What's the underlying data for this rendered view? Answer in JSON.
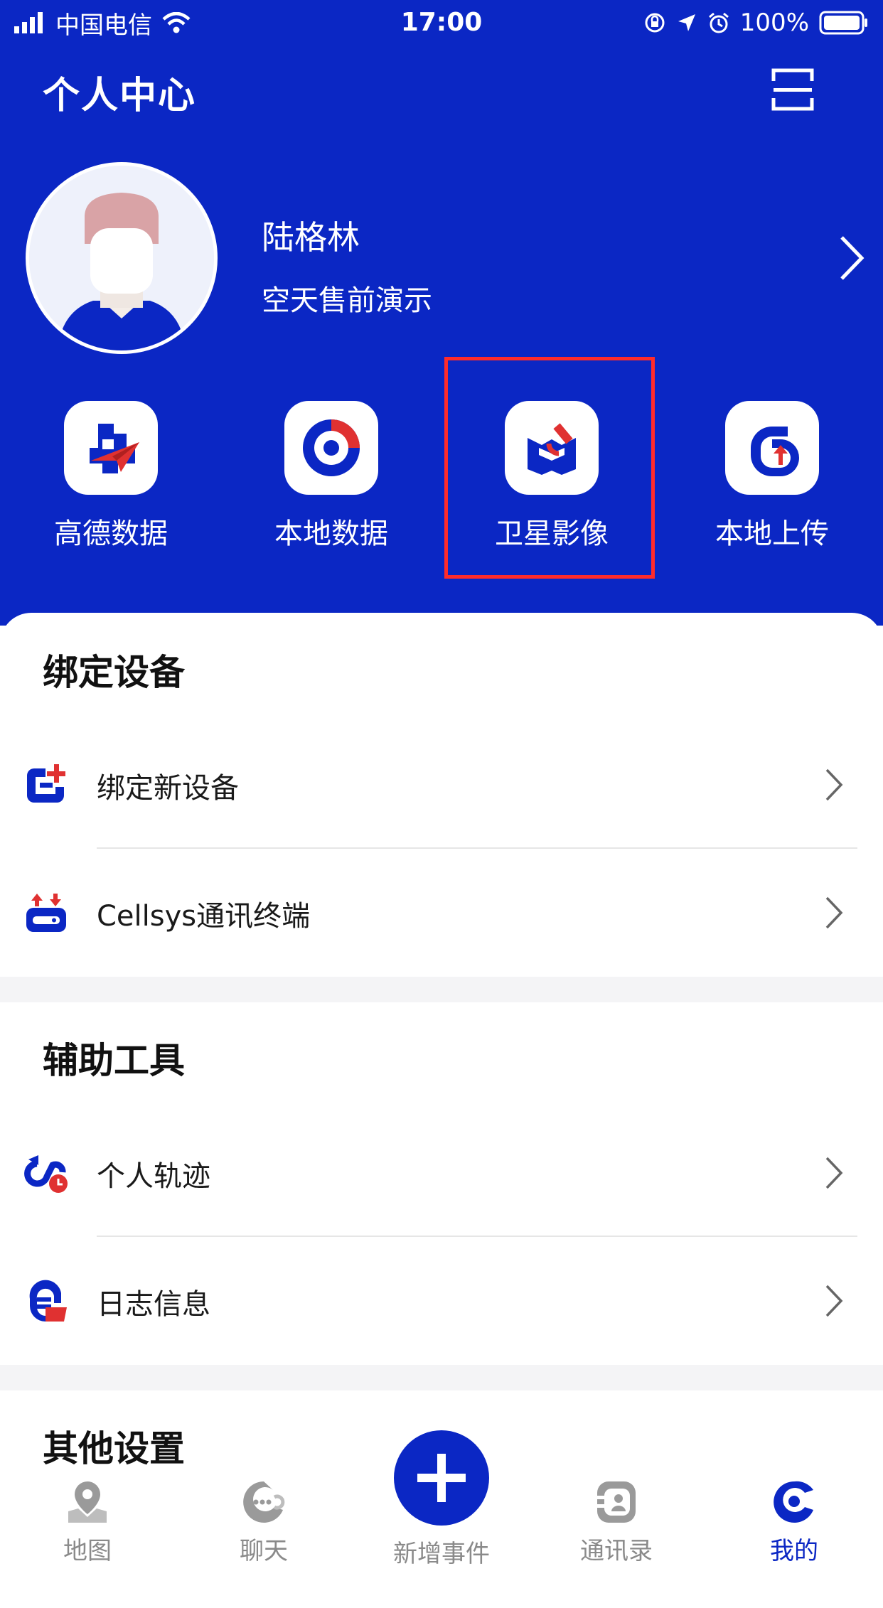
{
  "status_bar": {
    "carrier": "中国电信",
    "time": "17:00",
    "battery": "100%"
  },
  "header": {
    "title": "个人中心",
    "user": {
      "name": "陆格林",
      "org": "空天售前演示"
    },
    "quick_actions": [
      {
        "label": "高德数据",
        "icon": "gaode-data-icon"
      },
      {
        "label": "本地数据",
        "icon": "local-data-icon"
      },
      {
        "label": "卫星影像",
        "icon": "satellite-image-icon",
        "highlighted": true
      },
      {
        "label": "本地上传",
        "icon": "local-upload-icon"
      }
    ]
  },
  "sections": [
    {
      "title": "绑定设备",
      "items": [
        {
          "label": "绑定新设备"
        },
        {
          "label": "Cellsys通讯终端"
        }
      ]
    },
    {
      "title": "辅助工具",
      "items": [
        {
          "label": "个人轨迹"
        },
        {
          "label": "日志信息"
        }
      ]
    },
    {
      "title": "其他设置"
    }
  ],
  "tabbar": {
    "items": [
      {
        "label": "地图"
      },
      {
        "label": "聊天"
      },
      {
        "label": "新增事件"
      },
      {
        "label": "通讯录"
      },
      {
        "label": "我的",
        "active": true
      }
    ]
  },
  "colors": {
    "brand": "#0b27c4",
    "accent_red": "#e03131",
    "highlight_box": "#ff2b2b"
  }
}
